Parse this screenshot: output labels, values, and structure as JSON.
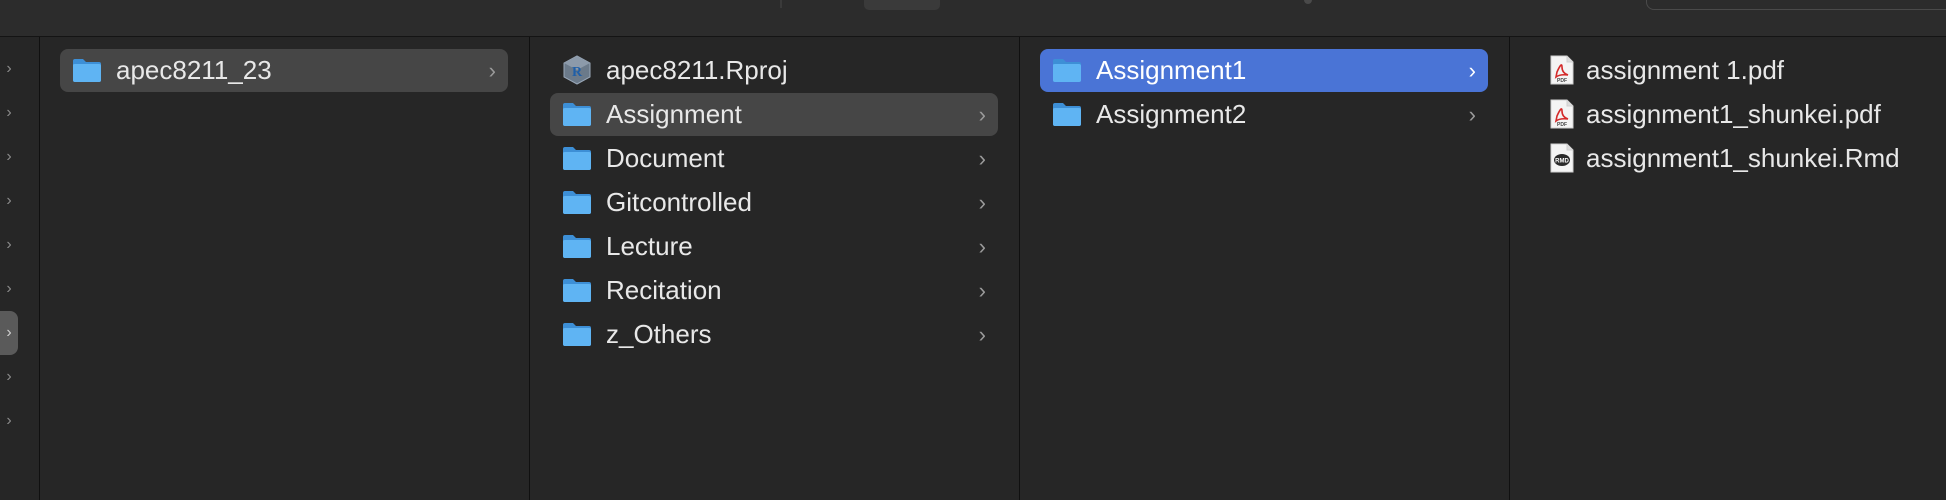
{
  "columns": [
    {
      "items": [
        {
          "label": "apec8211_23",
          "type": "folder",
          "state": "highlighted"
        }
      ]
    },
    {
      "items": [
        {
          "label": "apec8211.Rproj",
          "type": "rproj"
        },
        {
          "label": "Assignment",
          "type": "folder",
          "state": "highlighted"
        },
        {
          "label": "Document",
          "type": "folder"
        },
        {
          "label": "Gitcontrolled",
          "type": "folder"
        },
        {
          "label": "Lecture",
          "type": "folder"
        },
        {
          "label": "Recitation",
          "type": "folder"
        },
        {
          "label": "z_Others",
          "type": "folder"
        }
      ]
    },
    {
      "items": [
        {
          "label": "Assignment1",
          "type": "folder",
          "state": "selected"
        },
        {
          "label": "Assignment2",
          "type": "folder"
        }
      ]
    },
    {
      "items": [
        {
          "label": "assignment 1.pdf",
          "type": "pdf"
        },
        {
          "label": "assignment1_shunkei.pdf",
          "type": "pdf"
        },
        {
          "label": "assignment1_shunkei.Rmd",
          "type": "rmd"
        }
      ]
    }
  ],
  "icons": {
    "folder": "folder-icon",
    "rproj": "r-project-icon",
    "pdf": "pdf-icon",
    "rmd": "rmarkdown-icon",
    "chevron": "chevron-right-icon"
  },
  "colors": {
    "selection": "#4a74d6",
    "highlight": "#464646",
    "folder": "#5aaef0"
  }
}
